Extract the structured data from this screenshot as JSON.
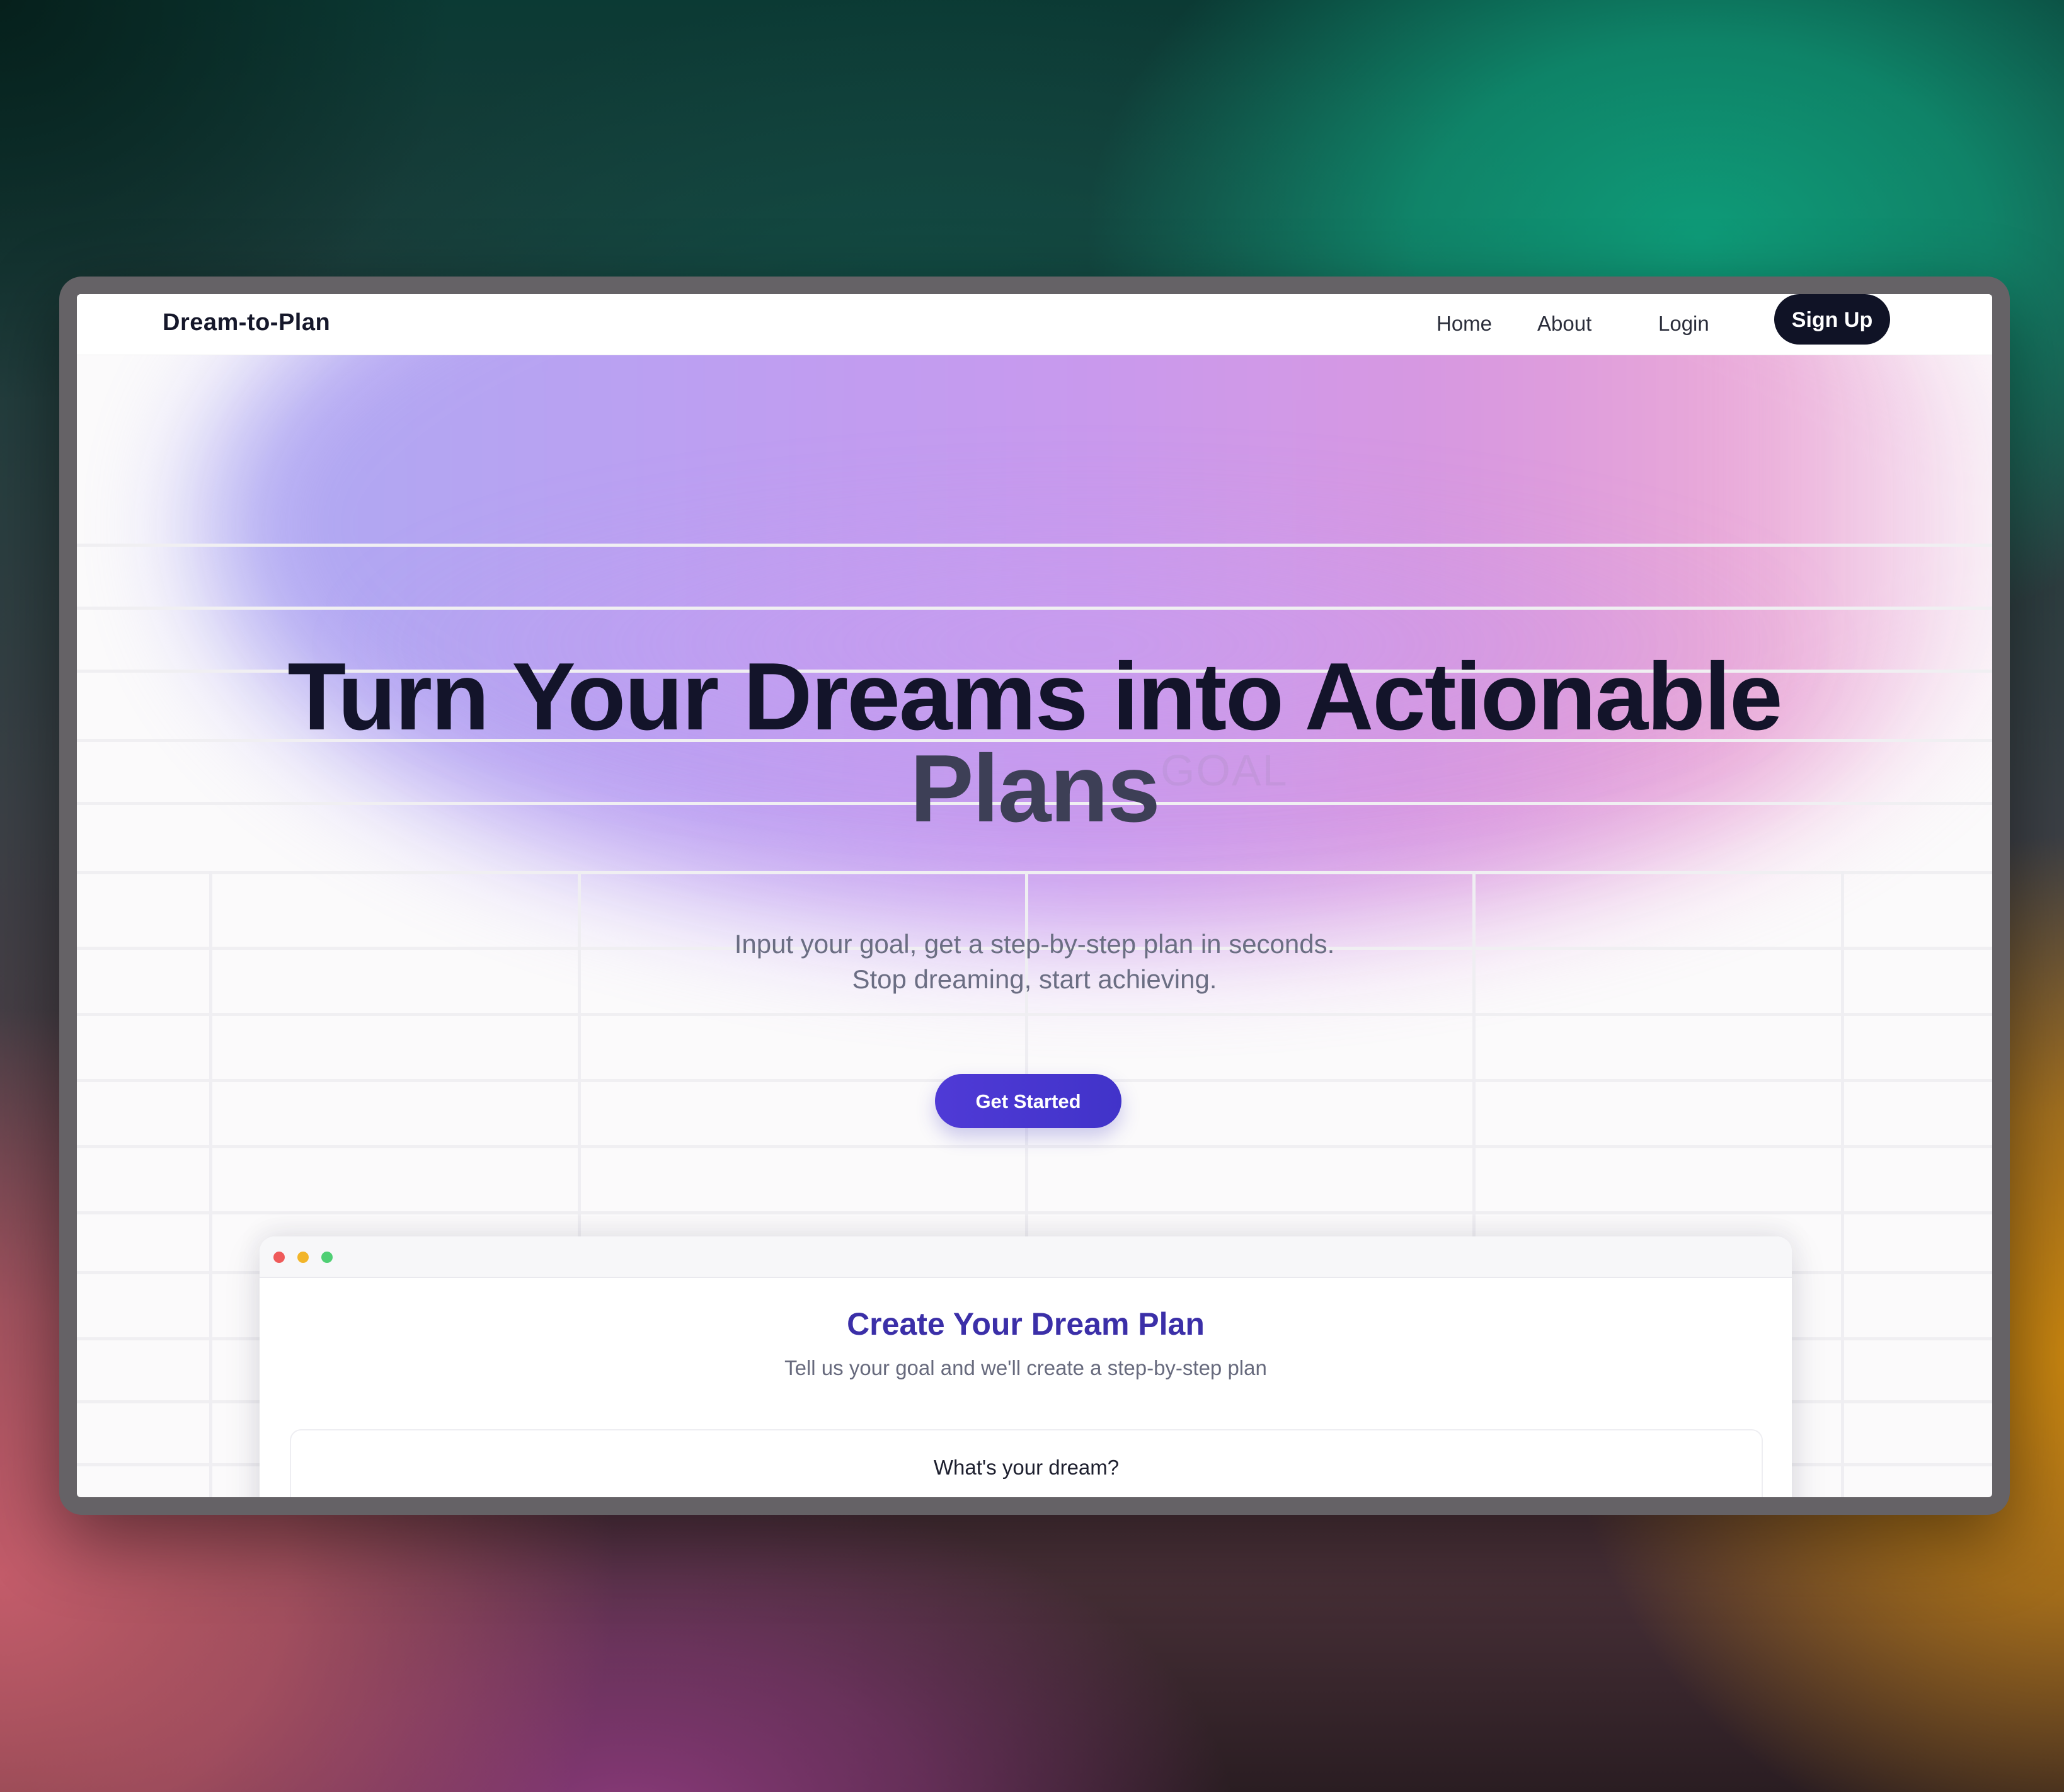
{
  "nav": {
    "brand": "Dream-to-Plan",
    "links": [
      {
        "label": "Home"
      },
      {
        "label": "About"
      },
      {
        "label": "Login"
      }
    ],
    "signup_label": "Sign Up"
  },
  "hero": {
    "headline_line1": "Turn Your Dreams into Actionable",
    "headline_line2": "Plans",
    "background_word": "GOAL",
    "subtitle_line1": "Input your goal, get a step-by-step plan in seconds.",
    "subtitle_line2": "Stop dreaming, start achieving.",
    "cta_label": "Get Started"
  },
  "mock_window": {
    "title": "Create Your Dream Plan",
    "subtitle": "Tell us your goal and we'll create a step-by-step plan",
    "form_label": "What's your dream?",
    "window_dots": [
      "#ef5a5a",
      "#f2b52a",
      "#4fcf74"
    ]
  },
  "colors": {
    "accent": "#4a37d0",
    "heading_dark": "#13142a",
    "mock_title": "#3b2fa8",
    "signup_bg": "#101326"
  }
}
